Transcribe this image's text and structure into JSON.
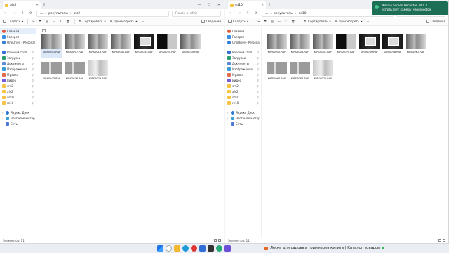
{
  "left": {
    "tab_title": "afs2",
    "breadcrumb": [
      "результаты",
      "afs2"
    ],
    "search_placeholder": "Поиск в: afs2",
    "toolbar": {
      "create": "Создать",
      "sort": "Сортировать",
      "view": "Просмотреть",
      "details": "Сведения"
    },
    "files": [
      {
        "name": "KIRS0001.RAF",
        "thumb": "gray"
      },
      {
        "name": "KIRS0007.RAF",
        "thumb": "gray"
      },
      {
        "name": "KIRS0013.RAF",
        "thumb": "gray"
      },
      {
        "name": "KIRS0040.RAF",
        "thumb": "gray"
      },
      {
        "name": "KIRS0043.RAF",
        "thumb": "dark"
      },
      {
        "name": "KIRS0055.RAF",
        "thumb": "split"
      },
      {
        "name": "KIRS0070.RAF",
        "thumb": "gray"
      },
      {
        "name": "KIRS0073.RAF",
        "thumb": "blank"
      },
      {
        "name": "KIRS0076.RAF",
        "thumb": "blank"
      },
      {
        "name": "KIRS0079.RAF",
        "thumb": "light"
      }
    ],
    "status": "Элементов: 11"
  },
  "right": {
    "tab_title": "sd10",
    "breadcrumb": [
      "результаты",
      "sd10"
    ],
    "search_placeholder": "Поиск в: sd10",
    "toolbar": {
      "create": "Создать",
      "sort": "Сортировать",
      "view": "Просмотреть",
      "details": "Сведения"
    },
    "files": [
      {
        "name": "KIRS0001.RAF",
        "thumb": "gray"
      },
      {
        "name": "KIRS0004.RAF",
        "thumb": "gray"
      },
      {
        "name": "KIRS0007.RAF",
        "thumb": "gray"
      },
      {
        "name": "KIRS0024.RAF",
        "thumb": "split"
      },
      {
        "name": "KIRS0039.RAF",
        "thumb": "dark"
      },
      {
        "name": "KIRS0048.RAF",
        "thumb": "dark"
      },
      {
        "name": "KIRS0061.RAF",
        "thumb": "gray"
      },
      {
        "name": "KIRS0064.RAF",
        "thumb": "blank"
      },
      {
        "name": "KIRS0067.RAF",
        "thumb": "blank"
      },
      {
        "name": "KIRS0070.RAF",
        "thumb": "light"
      }
    ],
    "status": "Элементов: 11"
  },
  "sidebar": {
    "top": [
      {
        "label": "Главная",
        "icon": "home-icon"
      },
      {
        "label": "Галерея",
        "icon": "gallery-icon"
      },
      {
        "label": "OneDrive - Personal",
        "icon": "cloud-icon"
      }
    ],
    "quick": [
      {
        "label": "Рабочий стол",
        "icon": "desktop-icon"
      },
      {
        "label": "Загрузки",
        "icon": "download-icon"
      },
      {
        "label": "Документы",
        "icon": "documents-icon"
      },
      {
        "label": "Изображения",
        "icon": "pictures-icon"
      },
      {
        "label": "Музыка",
        "icon": "music-icon"
      },
      {
        "label": "Видео",
        "icon": "video-icon"
      },
      {
        "label": "sr42",
        "icon": "folder-icon"
      },
      {
        "label": "afs2",
        "icon": "folder-icon"
      },
      {
        "label": "sd10",
        "icon": "folder-icon"
      },
      {
        "label": "rn10",
        "icon": "folder-icon"
      }
    ],
    "bottom": [
      {
        "label": "Яндекс Диск",
        "icon": "yandex-disk-icon"
      },
      {
        "label": "Этот компьютер",
        "icon": "computer-icon"
      },
      {
        "label": "Сеть",
        "icon": "network-icon"
      }
    ]
  },
  "toast": {
    "title": "Movavi Screen Recorder 24.0.0",
    "text": "использует камеру и микрофон"
  },
  "taskbar": {
    "news": "Леска для садовых триммеров купить | Каталог товаров"
  }
}
